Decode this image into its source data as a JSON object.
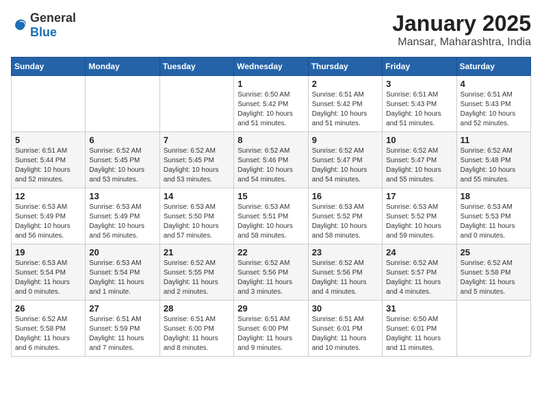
{
  "logo": {
    "general": "General",
    "blue": "Blue"
  },
  "header": {
    "month": "January 2025",
    "location": "Mansar, Maharashtra, India"
  },
  "weekdays": [
    "Sunday",
    "Monday",
    "Tuesday",
    "Wednesday",
    "Thursday",
    "Friday",
    "Saturday"
  ],
  "weeks": [
    [
      {
        "day": "",
        "info": ""
      },
      {
        "day": "",
        "info": ""
      },
      {
        "day": "",
        "info": ""
      },
      {
        "day": "1",
        "info": "Sunrise: 6:50 AM\nSunset: 5:42 PM\nDaylight: 10 hours\nand 51 minutes."
      },
      {
        "day": "2",
        "info": "Sunrise: 6:51 AM\nSunset: 5:42 PM\nDaylight: 10 hours\nand 51 minutes."
      },
      {
        "day": "3",
        "info": "Sunrise: 6:51 AM\nSunset: 5:43 PM\nDaylight: 10 hours\nand 51 minutes."
      },
      {
        "day": "4",
        "info": "Sunrise: 6:51 AM\nSunset: 5:43 PM\nDaylight: 10 hours\nand 52 minutes."
      }
    ],
    [
      {
        "day": "5",
        "info": "Sunrise: 6:51 AM\nSunset: 5:44 PM\nDaylight: 10 hours\nand 52 minutes."
      },
      {
        "day": "6",
        "info": "Sunrise: 6:52 AM\nSunset: 5:45 PM\nDaylight: 10 hours\nand 53 minutes."
      },
      {
        "day": "7",
        "info": "Sunrise: 6:52 AM\nSunset: 5:45 PM\nDaylight: 10 hours\nand 53 minutes."
      },
      {
        "day": "8",
        "info": "Sunrise: 6:52 AM\nSunset: 5:46 PM\nDaylight: 10 hours\nand 54 minutes."
      },
      {
        "day": "9",
        "info": "Sunrise: 6:52 AM\nSunset: 5:47 PM\nDaylight: 10 hours\nand 54 minutes."
      },
      {
        "day": "10",
        "info": "Sunrise: 6:52 AM\nSunset: 5:47 PM\nDaylight: 10 hours\nand 55 minutes."
      },
      {
        "day": "11",
        "info": "Sunrise: 6:52 AM\nSunset: 5:48 PM\nDaylight: 10 hours\nand 55 minutes."
      }
    ],
    [
      {
        "day": "12",
        "info": "Sunrise: 6:53 AM\nSunset: 5:49 PM\nDaylight: 10 hours\nand 56 minutes."
      },
      {
        "day": "13",
        "info": "Sunrise: 6:53 AM\nSunset: 5:49 PM\nDaylight: 10 hours\nand 56 minutes."
      },
      {
        "day": "14",
        "info": "Sunrise: 6:53 AM\nSunset: 5:50 PM\nDaylight: 10 hours\nand 57 minutes."
      },
      {
        "day": "15",
        "info": "Sunrise: 6:53 AM\nSunset: 5:51 PM\nDaylight: 10 hours\nand 58 minutes."
      },
      {
        "day": "16",
        "info": "Sunrise: 6:53 AM\nSunset: 5:52 PM\nDaylight: 10 hours\nand 58 minutes."
      },
      {
        "day": "17",
        "info": "Sunrise: 6:53 AM\nSunset: 5:52 PM\nDaylight: 10 hours\nand 59 minutes."
      },
      {
        "day": "18",
        "info": "Sunrise: 6:53 AM\nSunset: 5:53 PM\nDaylight: 11 hours\nand 0 minutes."
      }
    ],
    [
      {
        "day": "19",
        "info": "Sunrise: 6:53 AM\nSunset: 5:54 PM\nDaylight: 11 hours\nand 0 minutes."
      },
      {
        "day": "20",
        "info": "Sunrise: 6:53 AM\nSunset: 5:54 PM\nDaylight: 11 hours\nand 1 minute."
      },
      {
        "day": "21",
        "info": "Sunrise: 6:52 AM\nSunset: 5:55 PM\nDaylight: 11 hours\nand 2 minutes."
      },
      {
        "day": "22",
        "info": "Sunrise: 6:52 AM\nSunset: 5:56 PM\nDaylight: 11 hours\nand 3 minutes."
      },
      {
        "day": "23",
        "info": "Sunrise: 6:52 AM\nSunset: 5:56 PM\nDaylight: 11 hours\nand 4 minutes."
      },
      {
        "day": "24",
        "info": "Sunrise: 6:52 AM\nSunset: 5:57 PM\nDaylight: 11 hours\nand 4 minutes."
      },
      {
        "day": "25",
        "info": "Sunrise: 6:52 AM\nSunset: 5:58 PM\nDaylight: 11 hours\nand 5 minutes."
      }
    ],
    [
      {
        "day": "26",
        "info": "Sunrise: 6:52 AM\nSunset: 5:58 PM\nDaylight: 11 hours\nand 6 minutes."
      },
      {
        "day": "27",
        "info": "Sunrise: 6:51 AM\nSunset: 5:59 PM\nDaylight: 11 hours\nand 7 minutes."
      },
      {
        "day": "28",
        "info": "Sunrise: 6:51 AM\nSunset: 6:00 PM\nDaylight: 11 hours\nand 8 minutes."
      },
      {
        "day": "29",
        "info": "Sunrise: 6:51 AM\nSunset: 6:00 PM\nDaylight: 11 hours\nand 9 minutes."
      },
      {
        "day": "30",
        "info": "Sunrise: 6:51 AM\nSunset: 6:01 PM\nDaylight: 11 hours\nand 10 minutes."
      },
      {
        "day": "31",
        "info": "Sunrise: 6:50 AM\nSunset: 6:01 PM\nDaylight: 11 hours\nand 11 minutes."
      },
      {
        "day": "",
        "info": ""
      }
    ]
  ]
}
